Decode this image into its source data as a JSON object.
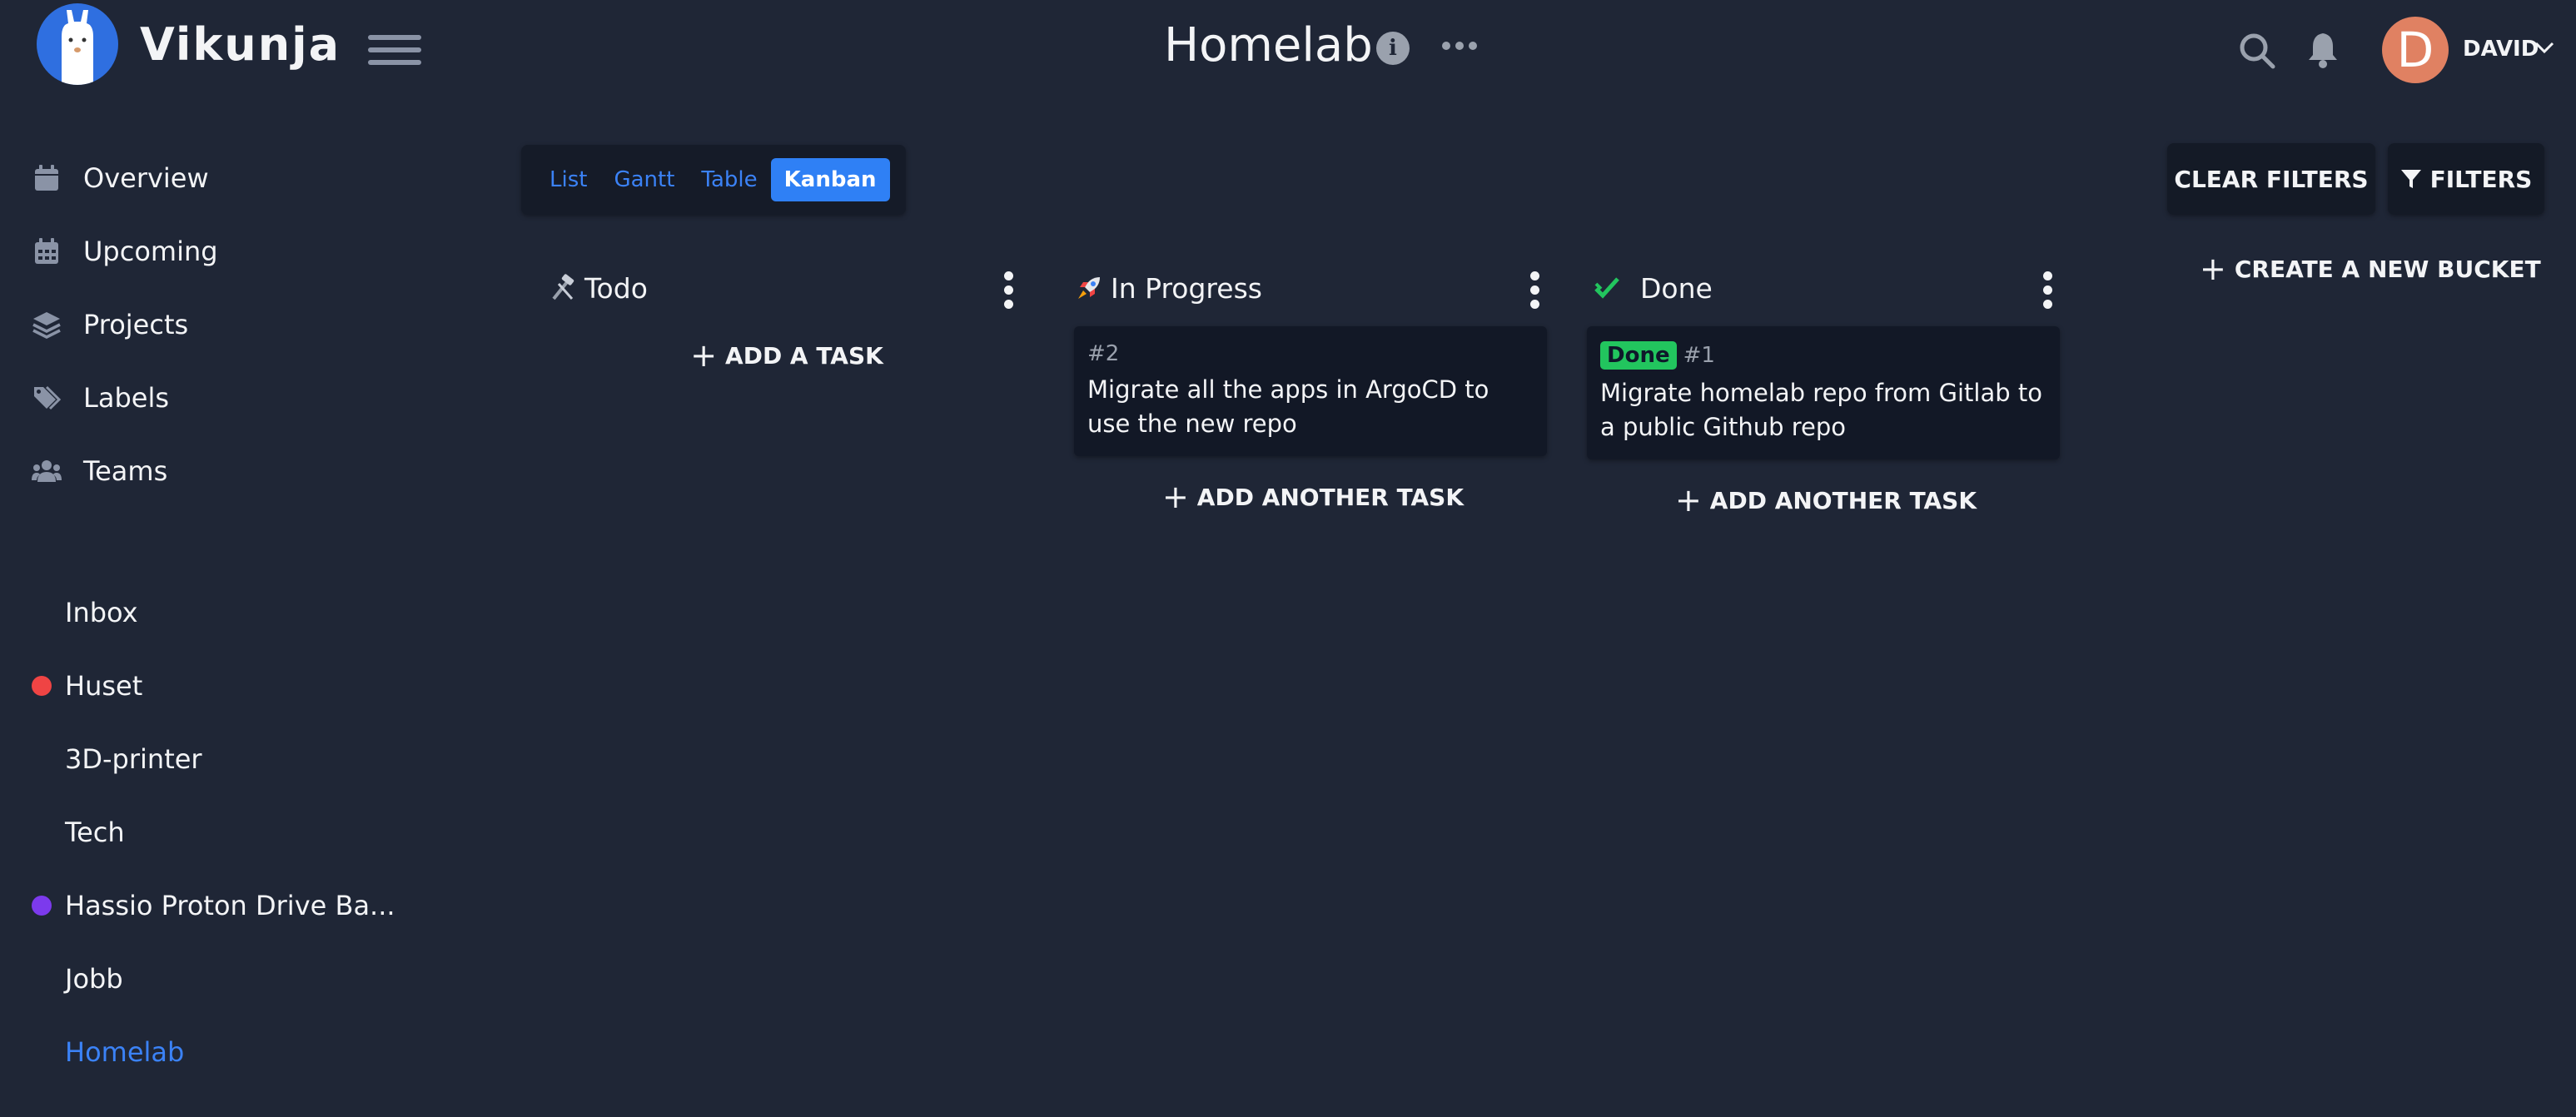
{
  "app": {
    "name": "Vikunja"
  },
  "header": {
    "title": "Homelab",
    "user_initial": "D",
    "user_name": "DAVID"
  },
  "menu": [
    {
      "label": "Overview",
      "icon": "calendar-icon"
    },
    {
      "label": "Upcoming",
      "icon": "calendar-grid-icon"
    },
    {
      "label": "Projects",
      "icon": "layers-icon"
    },
    {
      "label": "Labels",
      "icon": "tags-icon"
    },
    {
      "label": "Teams",
      "icon": "users-icon"
    }
  ],
  "projects": [
    {
      "label": "Inbox",
      "color": ""
    },
    {
      "label": "Huset",
      "color": "#ef4444"
    },
    {
      "label": "3D-printer",
      "color": ""
    },
    {
      "label": "Tech",
      "color": ""
    },
    {
      "label": "Hassio Proton Drive Ba...",
      "color": "#7c3aed"
    },
    {
      "label": "Jobb",
      "color": ""
    },
    {
      "label": "Homelab",
      "color": "",
      "active": true
    }
  ],
  "views": {
    "list": "List",
    "gantt": "Gantt",
    "table": "Table",
    "kanban": "Kanban"
  },
  "actions": {
    "clear_filters": "CLEAR FILTERS",
    "filters": "FILTERS",
    "create_bucket": "CREATE A NEW BUCKET"
  },
  "buckets": [
    {
      "title": "Todo",
      "icon": "hammer-wrench-icon",
      "add_label": "ADD A TASK",
      "tasks": []
    },
    {
      "title": "In Progress",
      "icon": "rocket-icon",
      "add_label": "ADD ANOTHER TASK",
      "tasks": [
        {
          "id": "#2",
          "title": "Migrate all the apps in ArgoCD to use the new repo",
          "done": false
        }
      ]
    },
    {
      "title": "Done",
      "icon": "check-icon",
      "add_label": "ADD ANOTHER TASK",
      "tasks": [
        {
          "id": "#1",
          "title": "Migrate homelab repo from Gitlab to a public Github repo",
          "done": true,
          "badge": "Done"
        }
      ]
    }
  ],
  "colors": {
    "background": "#1f2636",
    "accent": "#3b82f6",
    "done_badge": "#22c55e",
    "avatar": "#e08162"
  }
}
